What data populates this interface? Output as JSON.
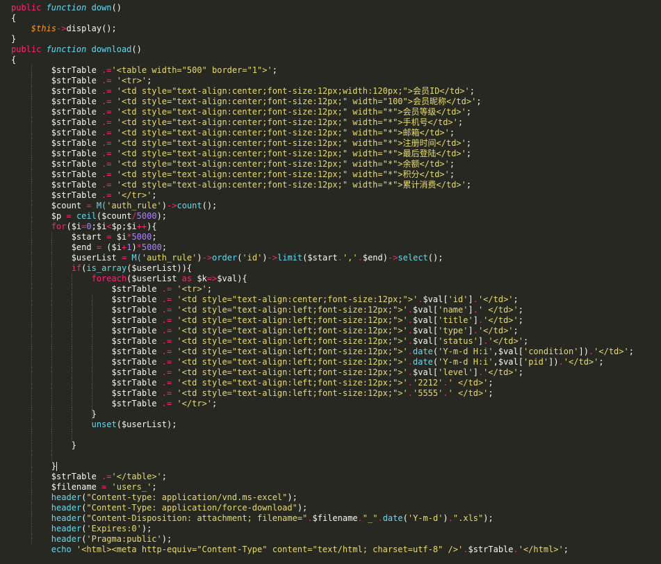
{
  "code_lines": [
    [
      {
        "t": "public ",
        "c": "kw"
      },
      {
        "t": "function ",
        "c": "ty"
      },
      {
        "t": "down",
        "c": "fn"
      },
      {
        "t": "()",
        "c": "pl"
      }
    ],
    [
      {
        "t": "{",
        "c": "pl"
      }
    ],
    [
      {
        "t": "    ",
        "c": "pl"
      },
      {
        "t": "$this",
        "c": "th"
      },
      {
        "t": "->",
        "c": "kw"
      },
      {
        "t": "display",
        "c": "pl"
      },
      {
        "t": "();",
        "c": "pl"
      }
    ],
    [
      {
        "t": "}",
        "c": "pl"
      }
    ],
    [
      {
        "t": "public ",
        "c": "kw"
      },
      {
        "t": "function ",
        "c": "ty"
      },
      {
        "t": "download",
        "c": "fn"
      },
      {
        "t": "()",
        "c": "pl"
      }
    ],
    [
      {
        "t": "{",
        "c": "pl"
      }
    ],
    [
      {
        "t": "        $strTable ",
        "c": "pl"
      },
      {
        "t": ".=",
        "c": "kw"
      },
      {
        "t": "'<table width=\"500\" border=\"1\">'",
        "c": "st"
      },
      {
        "t": ";",
        "c": "pl"
      }
    ],
    [
      {
        "t": "        $strTable ",
        "c": "pl"
      },
      {
        "t": ".=",
        "c": "kw"
      },
      {
        "t": " '<tr>'",
        "c": "st"
      },
      {
        "t": ";",
        "c": "pl"
      }
    ],
    [
      {
        "t": "        $strTable ",
        "c": "pl"
      },
      {
        "t": ".=",
        "c": "kw"
      },
      {
        "t": " '<td style=\"text-align:center;font-size:12px;width:120px;\">会员ID</td>'",
        "c": "st"
      },
      {
        "t": ";",
        "c": "pl"
      }
    ],
    [
      {
        "t": "        $strTable ",
        "c": "pl"
      },
      {
        "t": ".=",
        "c": "kw"
      },
      {
        "t": " '<td style=\"text-align:center;font-size:12px;\" width=\"100\">会员昵称</td>'",
        "c": "st"
      },
      {
        "t": ";",
        "c": "pl"
      }
    ],
    [
      {
        "t": "        $strTable ",
        "c": "pl"
      },
      {
        "t": ".=",
        "c": "kw"
      },
      {
        "t": " '<td style=\"text-align:center;font-size:12px;\" width=\"*\">会员等级</td>'",
        "c": "st"
      },
      {
        "t": ";",
        "c": "pl"
      }
    ],
    [
      {
        "t": "        $strTable ",
        "c": "pl"
      },
      {
        "t": ".=",
        "c": "kw"
      },
      {
        "t": " '<td style=\"text-align:center;font-size:12px;\" width=\"*\">手机号</td>'",
        "c": "st"
      },
      {
        "t": ";",
        "c": "pl"
      }
    ],
    [
      {
        "t": "        $strTable ",
        "c": "pl"
      },
      {
        "t": ".=",
        "c": "kw"
      },
      {
        "t": " '<td style=\"text-align:center;font-size:12px;\" width=\"*\">邮箱</td>'",
        "c": "st"
      },
      {
        "t": ";",
        "c": "pl"
      }
    ],
    [
      {
        "t": "        $strTable ",
        "c": "pl"
      },
      {
        "t": ".=",
        "c": "kw"
      },
      {
        "t": " '<td style=\"text-align:center;font-size:12px;\" width=\"*\">注册时间</td>'",
        "c": "st"
      },
      {
        "t": ";",
        "c": "pl"
      }
    ],
    [
      {
        "t": "        $strTable ",
        "c": "pl"
      },
      {
        "t": ".=",
        "c": "kw"
      },
      {
        "t": " '<td style=\"text-align:center;font-size:12px;\" width=\"*\">最后登陆</td>'",
        "c": "st"
      },
      {
        "t": ";",
        "c": "pl"
      }
    ],
    [
      {
        "t": "        $strTable ",
        "c": "pl"
      },
      {
        "t": ".=",
        "c": "kw"
      },
      {
        "t": " '<td style=\"text-align:center;font-size:12px;\" width=\"*\">余额</td>'",
        "c": "st"
      },
      {
        "t": ";",
        "c": "pl"
      }
    ],
    [
      {
        "t": "        $strTable ",
        "c": "pl"
      },
      {
        "t": ".=",
        "c": "kw"
      },
      {
        "t": " '<td style=\"text-align:center;font-size:12px;\" width=\"*\">积分</td>'",
        "c": "st"
      },
      {
        "t": ";",
        "c": "pl"
      }
    ],
    [
      {
        "t": "        $strTable ",
        "c": "pl"
      },
      {
        "t": ".=",
        "c": "kw"
      },
      {
        "t": " '<td style=\"text-align:center;font-size:12px;\" width=\"*\">累计消费</td>'",
        "c": "st"
      },
      {
        "t": ";",
        "c": "pl"
      }
    ],
    [
      {
        "t": "        $strTable ",
        "c": "pl"
      },
      {
        "t": ".=",
        "c": "kw"
      },
      {
        "t": " '</tr>'",
        "c": "st"
      },
      {
        "t": ";",
        "c": "pl"
      }
    ],
    [
      {
        "t": "        $count ",
        "c": "pl"
      },
      {
        "t": "=",
        "c": "kw"
      },
      {
        "t": " M(",
        "c": "fn"
      },
      {
        "t": "'auth_rule'",
        "c": "st"
      },
      {
        "t": ")",
        "c": "pl"
      },
      {
        "t": "->",
        "c": "kw"
      },
      {
        "t": "count",
        "c": "fn"
      },
      {
        "t": "();",
        "c": "pl"
      }
    ],
    [
      {
        "t": "        $p ",
        "c": "pl"
      },
      {
        "t": "=",
        "c": "kw"
      },
      {
        "t": " ceil",
        "c": "fn"
      },
      {
        "t": "($count",
        "c": "pl"
      },
      {
        "t": "/",
        "c": "kw"
      },
      {
        "t": "5000",
        "c": "nu"
      },
      {
        "t": ");",
        "c": "pl"
      }
    ],
    [
      {
        "t": "        ",
        "c": "pl"
      },
      {
        "t": "for",
        "c": "kw"
      },
      {
        "t": "($i",
        "c": "pl"
      },
      {
        "t": "=",
        "c": "kw"
      },
      {
        "t": "0",
        "c": "nu"
      },
      {
        "t": ";$i",
        "c": "pl"
      },
      {
        "t": "<",
        "c": "kw"
      },
      {
        "t": "$p;$i",
        "c": "pl"
      },
      {
        "t": "++",
        "c": "kw"
      },
      {
        "t": "){",
        "c": "pl"
      }
    ],
    [
      {
        "t": "            $start ",
        "c": "pl"
      },
      {
        "t": "=",
        "c": "kw"
      },
      {
        "t": " $i",
        "c": "pl"
      },
      {
        "t": "*",
        "c": "kw"
      },
      {
        "t": "5000",
        "c": "nu"
      },
      {
        "t": ";",
        "c": "pl"
      }
    ],
    [
      {
        "t": "            $end ",
        "c": "pl"
      },
      {
        "t": "=",
        "c": "kw"
      },
      {
        "t": " ($i",
        "c": "pl"
      },
      {
        "t": "+",
        "c": "kw"
      },
      {
        "t": "1",
        "c": "nu"
      },
      {
        "t": ")",
        "c": "pl"
      },
      {
        "t": "*",
        "c": "kw"
      },
      {
        "t": "5000",
        "c": "nu"
      },
      {
        "t": ";",
        "c": "pl"
      }
    ],
    [
      {
        "t": "            $userList ",
        "c": "pl"
      },
      {
        "t": "=",
        "c": "kw"
      },
      {
        "t": " M(",
        "c": "fn"
      },
      {
        "t": "'auth_rule'",
        "c": "st"
      },
      {
        "t": ")",
        "c": "pl"
      },
      {
        "t": "->",
        "c": "kw"
      },
      {
        "t": "order",
        "c": "fn"
      },
      {
        "t": "(",
        "c": "pl"
      },
      {
        "t": "'id'",
        "c": "st"
      },
      {
        "t": ")",
        "c": "pl"
      },
      {
        "t": "->",
        "c": "kw"
      },
      {
        "t": "limit",
        "c": "fn"
      },
      {
        "t": "($start",
        "c": "pl"
      },
      {
        "t": ".",
        "c": "kw"
      },
      {
        "t": "','",
        "c": "st"
      },
      {
        "t": ".",
        "c": "kw"
      },
      {
        "t": "$end)",
        "c": "pl"
      },
      {
        "t": "->",
        "c": "kw"
      },
      {
        "t": "select",
        "c": "fn"
      },
      {
        "t": "();",
        "c": "pl"
      }
    ],
    [
      {
        "t": "            ",
        "c": "pl"
      },
      {
        "t": "if",
        "c": "kw"
      },
      {
        "t": "(",
        "c": "pl"
      },
      {
        "t": "is_array",
        "c": "fn"
      },
      {
        "t": "($userList)){",
        "c": "pl"
      }
    ],
    [
      {
        "t": "                ",
        "c": "pl"
      },
      {
        "t": "foreach",
        "c": "kw"
      },
      {
        "t": "($userList ",
        "c": "pl"
      },
      {
        "t": "as",
        "c": "kw"
      },
      {
        "t": " $k",
        "c": "pl"
      },
      {
        "t": "=>",
        "c": "kw"
      },
      {
        "t": "$val){",
        "c": "pl"
      }
    ],
    [
      {
        "t": "                    $strTable ",
        "c": "pl"
      },
      {
        "t": ".=",
        "c": "kw"
      },
      {
        "t": " '<tr>'",
        "c": "st"
      },
      {
        "t": ";",
        "c": "pl"
      }
    ],
    [
      {
        "t": "                    $strTable ",
        "c": "pl"
      },
      {
        "t": ".=",
        "c": "kw"
      },
      {
        "t": " '<td style=\"text-align:center;font-size:12px;\">'",
        "c": "st"
      },
      {
        "t": ".",
        "c": "kw"
      },
      {
        "t": "$val[",
        "c": "pl"
      },
      {
        "t": "'id'",
        "c": "st"
      },
      {
        "t": "]",
        "c": "pl"
      },
      {
        "t": ".",
        "c": "kw"
      },
      {
        "t": "'</td>'",
        "c": "st"
      },
      {
        "t": ";",
        "c": "pl"
      }
    ],
    [
      {
        "t": "                    $strTable ",
        "c": "pl"
      },
      {
        "t": ".=",
        "c": "kw"
      },
      {
        "t": " '<td style=\"text-align:left;font-size:12px;\">'",
        "c": "st"
      },
      {
        "t": ".",
        "c": "kw"
      },
      {
        "t": "$val[",
        "c": "pl"
      },
      {
        "t": "'name'",
        "c": "st"
      },
      {
        "t": "]",
        "c": "pl"
      },
      {
        "t": ".",
        "c": "kw"
      },
      {
        "t": "' </td>'",
        "c": "st"
      },
      {
        "t": ";",
        "c": "pl"
      }
    ],
    [
      {
        "t": "                    $strTable ",
        "c": "pl"
      },
      {
        "t": ".=",
        "c": "kw"
      },
      {
        "t": " '<td style=\"text-align:left;font-size:12px;\">'",
        "c": "st"
      },
      {
        "t": ".",
        "c": "kw"
      },
      {
        "t": "$val[",
        "c": "pl"
      },
      {
        "t": "'title'",
        "c": "st"
      },
      {
        "t": "]",
        "c": "pl"
      },
      {
        "t": ".",
        "c": "kw"
      },
      {
        "t": "'</td>'",
        "c": "st"
      },
      {
        "t": ";",
        "c": "pl"
      }
    ],
    [
      {
        "t": "                    $strTable ",
        "c": "pl"
      },
      {
        "t": ".=",
        "c": "kw"
      },
      {
        "t": " '<td style=\"text-align:left;font-size:12px;\">'",
        "c": "st"
      },
      {
        "t": ".",
        "c": "kw"
      },
      {
        "t": "$val[",
        "c": "pl"
      },
      {
        "t": "'type'",
        "c": "st"
      },
      {
        "t": "]",
        "c": "pl"
      },
      {
        "t": ".",
        "c": "kw"
      },
      {
        "t": "'</td>'",
        "c": "st"
      },
      {
        "t": ";",
        "c": "pl"
      }
    ],
    [
      {
        "t": "                    $strTable ",
        "c": "pl"
      },
      {
        "t": ".=",
        "c": "kw"
      },
      {
        "t": " '<td style=\"text-align:left;font-size:12px;\">'",
        "c": "st"
      },
      {
        "t": ".",
        "c": "kw"
      },
      {
        "t": "$val[",
        "c": "pl"
      },
      {
        "t": "'status'",
        "c": "st"
      },
      {
        "t": "]",
        "c": "pl"
      },
      {
        "t": ".",
        "c": "kw"
      },
      {
        "t": "'</td>'",
        "c": "st"
      },
      {
        "t": ";",
        "c": "pl"
      }
    ],
    [
      {
        "t": "                    $strTable ",
        "c": "pl"
      },
      {
        "t": ".=",
        "c": "kw"
      },
      {
        "t": " '<td style=\"text-align:left;font-size:12px;\">'",
        "c": "st"
      },
      {
        "t": ".",
        "c": "kw"
      },
      {
        "t": "date",
        "c": "fn"
      },
      {
        "t": "(",
        "c": "pl"
      },
      {
        "t": "'Y-m-d H:i'",
        "c": "st"
      },
      {
        "t": ",$val[",
        "c": "pl"
      },
      {
        "t": "'condition'",
        "c": "st"
      },
      {
        "t": "])",
        "c": "pl"
      },
      {
        "t": ".",
        "c": "kw"
      },
      {
        "t": "'</td>'",
        "c": "st"
      },
      {
        "t": ";",
        "c": "pl"
      }
    ],
    [
      {
        "t": "                    $strTable ",
        "c": "pl"
      },
      {
        "t": ".=",
        "c": "kw"
      },
      {
        "t": " '<td style=\"text-align:left;font-size:12px;\">'",
        "c": "st"
      },
      {
        "t": ".",
        "c": "kw"
      },
      {
        "t": "date",
        "c": "fn"
      },
      {
        "t": "(",
        "c": "pl"
      },
      {
        "t": "'Y-m-d H:i'",
        "c": "st"
      },
      {
        "t": ",$val[",
        "c": "pl"
      },
      {
        "t": "'pid'",
        "c": "st"
      },
      {
        "t": "])",
        "c": "pl"
      },
      {
        "t": ".",
        "c": "kw"
      },
      {
        "t": "'</td>'",
        "c": "st"
      },
      {
        "t": ";",
        "c": "pl"
      }
    ],
    [
      {
        "t": "                    $strTable ",
        "c": "pl"
      },
      {
        "t": ".=",
        "c": "kw"
      },
      {
        "t": " '<td style=\"text-align:left;font-size:12px;\">'",
        "c": "st"
      },
      {
        "t": ".",
        "c": "kw"
      },
      {
        "t": "$val[",
        "c": "pl"
      },
      {
        "t": "'level'",
        "c": "st"
      },
      {
        "t": "]",
        "c": "pl"
      },
      {
        "t": ".",
        "c": "kw"
      },
      {
        "t": "'</td>'",
        "c": "st"
      },
      {
        "t": ";",
        "c": "pl"
      }
    ],
    [
      {
        "t": "                    $strTable ",
        "c": "pl"
      },
      {
        "t": ".=",
        "c": "kw"
      },
      {
        "t": " '<td style=\"text-align:left;font-size:12px;\">'",
        "c": "st"
      },
      {
        "t": ".",
        "c": "kw"
      },
      {
        "t": "'2212'",
        "c": "st"
      },
      {
        "t": ".",
        "c": "kw"
      },
      {
        "t": "' </td>'",
        "c": "st"
      },
      {
        "t": ";",
        "c": "pl"
      }
    ],
    [
      {
        "t": "                    $strTable ",
        "c": "pl"
      },
      {
        "t": ".=",
        "c": "kw"
      },
      {
        "t": " '<td style=\"text-align:left;font-size:12px;\">'",
        "c": "st"
      },
      {
        "t": ".",
        "c": "kw"
      },
      {
        "t": "'5555'",
        "c": "st"
      },
      {
        "t": ".",
        "c": "kw"
      },
      {
        "t": "' </td>'",
        "c": "st"
      },
      {
        "t": ";",
        "c": "pl"
      }
    ],
    [
      {
        "t": "                    $strTable ",
        "c": "pl"
      },
      {
        "t": ".=",
        "c": "kw"
      },
      {
        "t": " '</tr>'",
        "c": "st"
      },
      {
        "t": ";",
        "c": "pl"
      }
    ],
    [
      {
        "t": "                }",
        "c": "pl"
      }
    ],
    [
      {
        "t": "                ",
        "c": "pl"
      },
      {
        "t": "unset",
        "c": "fn"
      },
      {
        "t": "($userList);",
        "c": "pl"
      }
    ],
    [],
    [
      {
        "t": "            }",
        "c": "pl"
      }
    ],
    [],
    [
      {
        "t": "        }",
        "c": "pl"
      }
    ],
    [
      {
        "t": "        $strTable ",
        "c": "pl"
      },
      {
        "t": ".=",
        "c": "kw"
      },
      {
        "t": "'</table>'",
        "c": "st"
      },
      {
        "t": ";",
        "c": "pl"
      }
    ],
    [
      {
        "t": "        $filename ",
        "c": "pl"
      },
      {
        "t": "=",
        "c": "kw"
      },
      {
        "t": " 'users_'",
        "c": "st"
      },
      {
        "t": ";",
        "c": "pl"
      }
    ],
    [
      {
        "t": "        ",
        "c": "pl"
      },
      {
        "t": "header",
        "c": "fn"
      },
      {
        "t": "(",
        "c": "pl"
      },
      {
        "t": "\"Content-type: application/vnd.ms-excel\"",
        "c": "st"
      },
      {
        "t": ");",
        "c": "pl"
      }
    ],
    [
      {
        "t": "        ",
        "c": "pl"
      },
      {
        "t": "header",
        "c": "fn"
      },
      {
        "t": "(",
        "c": "pl"
      },
      {
        "t": "\"Content-Type: application/force-download\"",
        "c": "st"
      },
      {
        "t": ");",
        "c": "pl"
      }
    ],
    [
      {
        "t": "        ",
        "c": "pl"
      },
      {
        "t": "header",
        "c": "fn"
      },
      {
        "t": "(",
        "c": "pl"
      },
      {
        "t": "\"Content-Disposition: attachment; filename=\"",
        "c": "st"
      },
      {
        "t": ".",
        "c": "kw"
      },
      {
        "t": "$filename",
        "c": "pl"
      },
      {
        "t": ".",
        "c": "kw"
      },
      {
        "t": "\"_\"",
        "c": "st"
      },
      {
        "t": ".",
        "c": "kw"
      },
      {
        "t": "date",
        "c": "fn"
      },
      {
        "t": "(",
        "c": "pl"
      },
      {
        "t": "'Y-m-d'",
        "c": "st"
      },
      {
        "t": ")",
        "c": "pl"
      },
      {
        "t": ".",
        "c": "kw"
      },
      {
        "t": "\".xls\"",
        "c": "st"
      },
      {
        "t": ");",
        "c": "pl"
      }
    ],
    [
      {
        "t": "        ",
        "c": "pl"
      },
      {
        "t": "header",
        "c": "fn"
      },
      {
        "t": "(",
        "c": "pl"
      },
      {
        "t": "'Expires:0'",
        "c": "st"
      },
      {
        "t": ");",
        "c": "pl"
      }
    ],
    [
      {
        "t": "        ",
        "c": "pl"
      },
      {
        "t": "header",
        "c": "fn"
      },
      {
        "t": "(",
        "c": "pl"
      },
      {
        "t": "'Pragma:public'",
        "c": "st"
      },
      {
        "t": ");",
        "c": "pl"
      }
    ],
    [
      {
        "t": "        ",
        "c": "pl"
      },
      {
        "t": "echo",
        "c": "fn"
      },
      {
        "t": " '<html><meta http-equiv=\"Content-Type\" content=\"text/html; charset=utf-8\" />'",
        "c": "st"
      },
      {
        "t": ".",
        "c": "kw"
      },
      {
        "t": "$strTable",
        "c": "pl"
      },
      {
        "t": ".",
        "c": "kw"
      },
      {
        "t": "'</html>'",
        "c": "st"
      },
      {
        "t": ";",
        "c": "pl"
      }
    ]
  ]
}
